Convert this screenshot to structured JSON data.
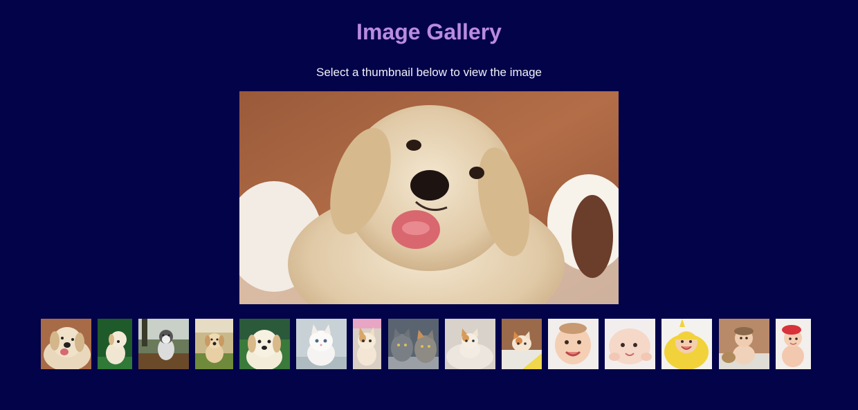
{
  "header": {
    "title": "Image Gallery",
    "subtitle": "Select a thumbnail below to view the image"
  },
  "main_image": {
    "icon": "puppy-photo",
    "subject": "golden retriever puppy"
  },
  "thumbnails": [
    {
      "icon": "puppy-photo",
      "subject": "puppy smiling"
    },
    {
      "icon": "puppy-photo",
      "subject": "puppy on grass"
    },
    {
      "icon": "puppy-photo",
      "subject": "husky puppy"
    },
    {
      "icon": "puppy-photo",
      "subject": "puppy running"
    },
    {
      "icon": "puppy-photo",
      "subject": "puppy close-up"
    },
    {
      "icon": "kitten-photo",
      "subject": "white kitten"
    },
    {
      "icon": "kitten-photo",
      "subject": "kitten sitting"
    },
    {
      "icon": "kitten-photo",
      "subject": "two kittens"
    },
    {
      "icon": "kitten-photo",
      "subject": "kitten on blanket"
    },
    {
      "icon": "kitten-photo",
      "subject": "kitten lying"
    },
    {
      "icon": "baby-photo",
      "subject": "baby smiling"
    },
    {
      "icon": "baby-photo",
      "subject": "baby lying"
    },
    {
      "icon": "baby-photo",
      "subject": "baby in yellow towel"
    },
    {
      "icon": "baby-photo",
      "subject": "baby sitting"
    },
    {
      "icon": "baby-photo",
      "subject": "baby with red hat"
    }
  ],
  "colors": {
    "background": "#03034a",
    "title": "#b98be0",
    "subtitle": "#f1f1f8"
  }
}
